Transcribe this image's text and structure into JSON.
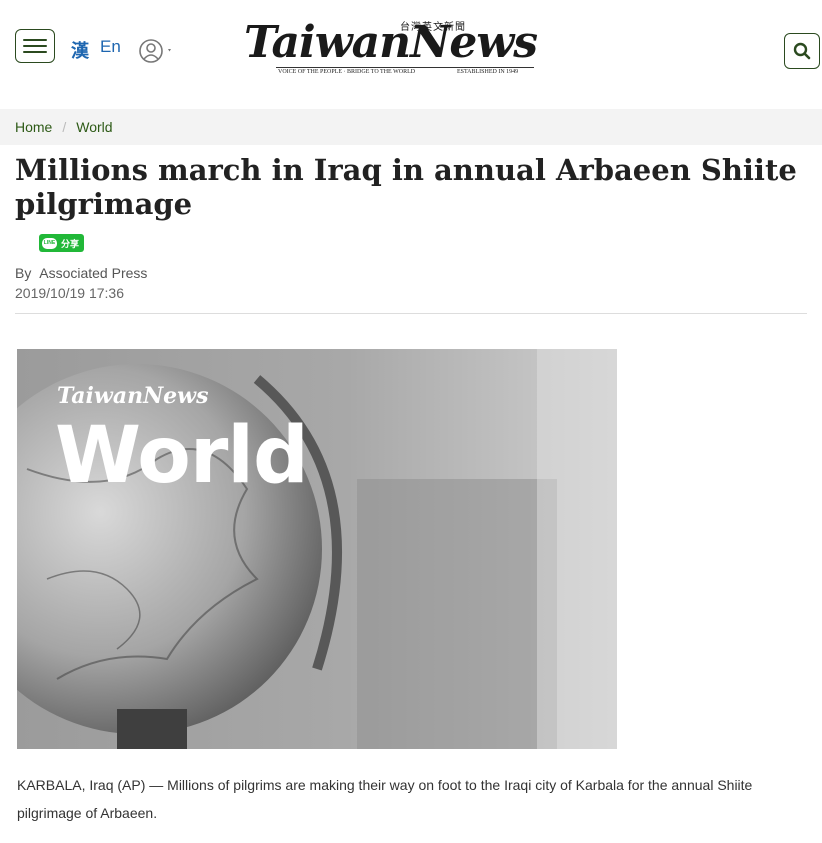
{
  "header": {
    "lang_zh": "漢",
    "lang_en": "En",
    "logo_name": "TaiwanNews",
    "logo_zh": "台灣英文新聞",
    "logo_tagline_left": "VOICE OF THE PEOPLE · BRIDGE TO THE WORLD",
    "logo_tagline_right": "ESTABLISHED IN 1949"
  },
  "breadcrumb": {
    "home": "Home",
    "section": "World"
  },
  "article": {
    "title": "Millions march in Iraq in annual Arbaeen Shiite pilgrimage",
    "share_logo": "LINE",
    "share_label": "分享",
    "by_label": "By",
    "author": "Associated Press",
    "date": "2019/10/19 17:36",
    "hero_brand": "TaiwanNews",
    "hero_title": "World",
    "body": "KARBALA, Iraq (AP) — Millions of pilgrims are making their way on foot to the Iraqi city of Karbala for the annual Shiite pilgrimage of Arbaeen."
  },
  "colors": {
    "brand_green": "#2b4a1f",
    "link_blue": "#1e66b0",
    "line_green": "#21b838"
  }
}
